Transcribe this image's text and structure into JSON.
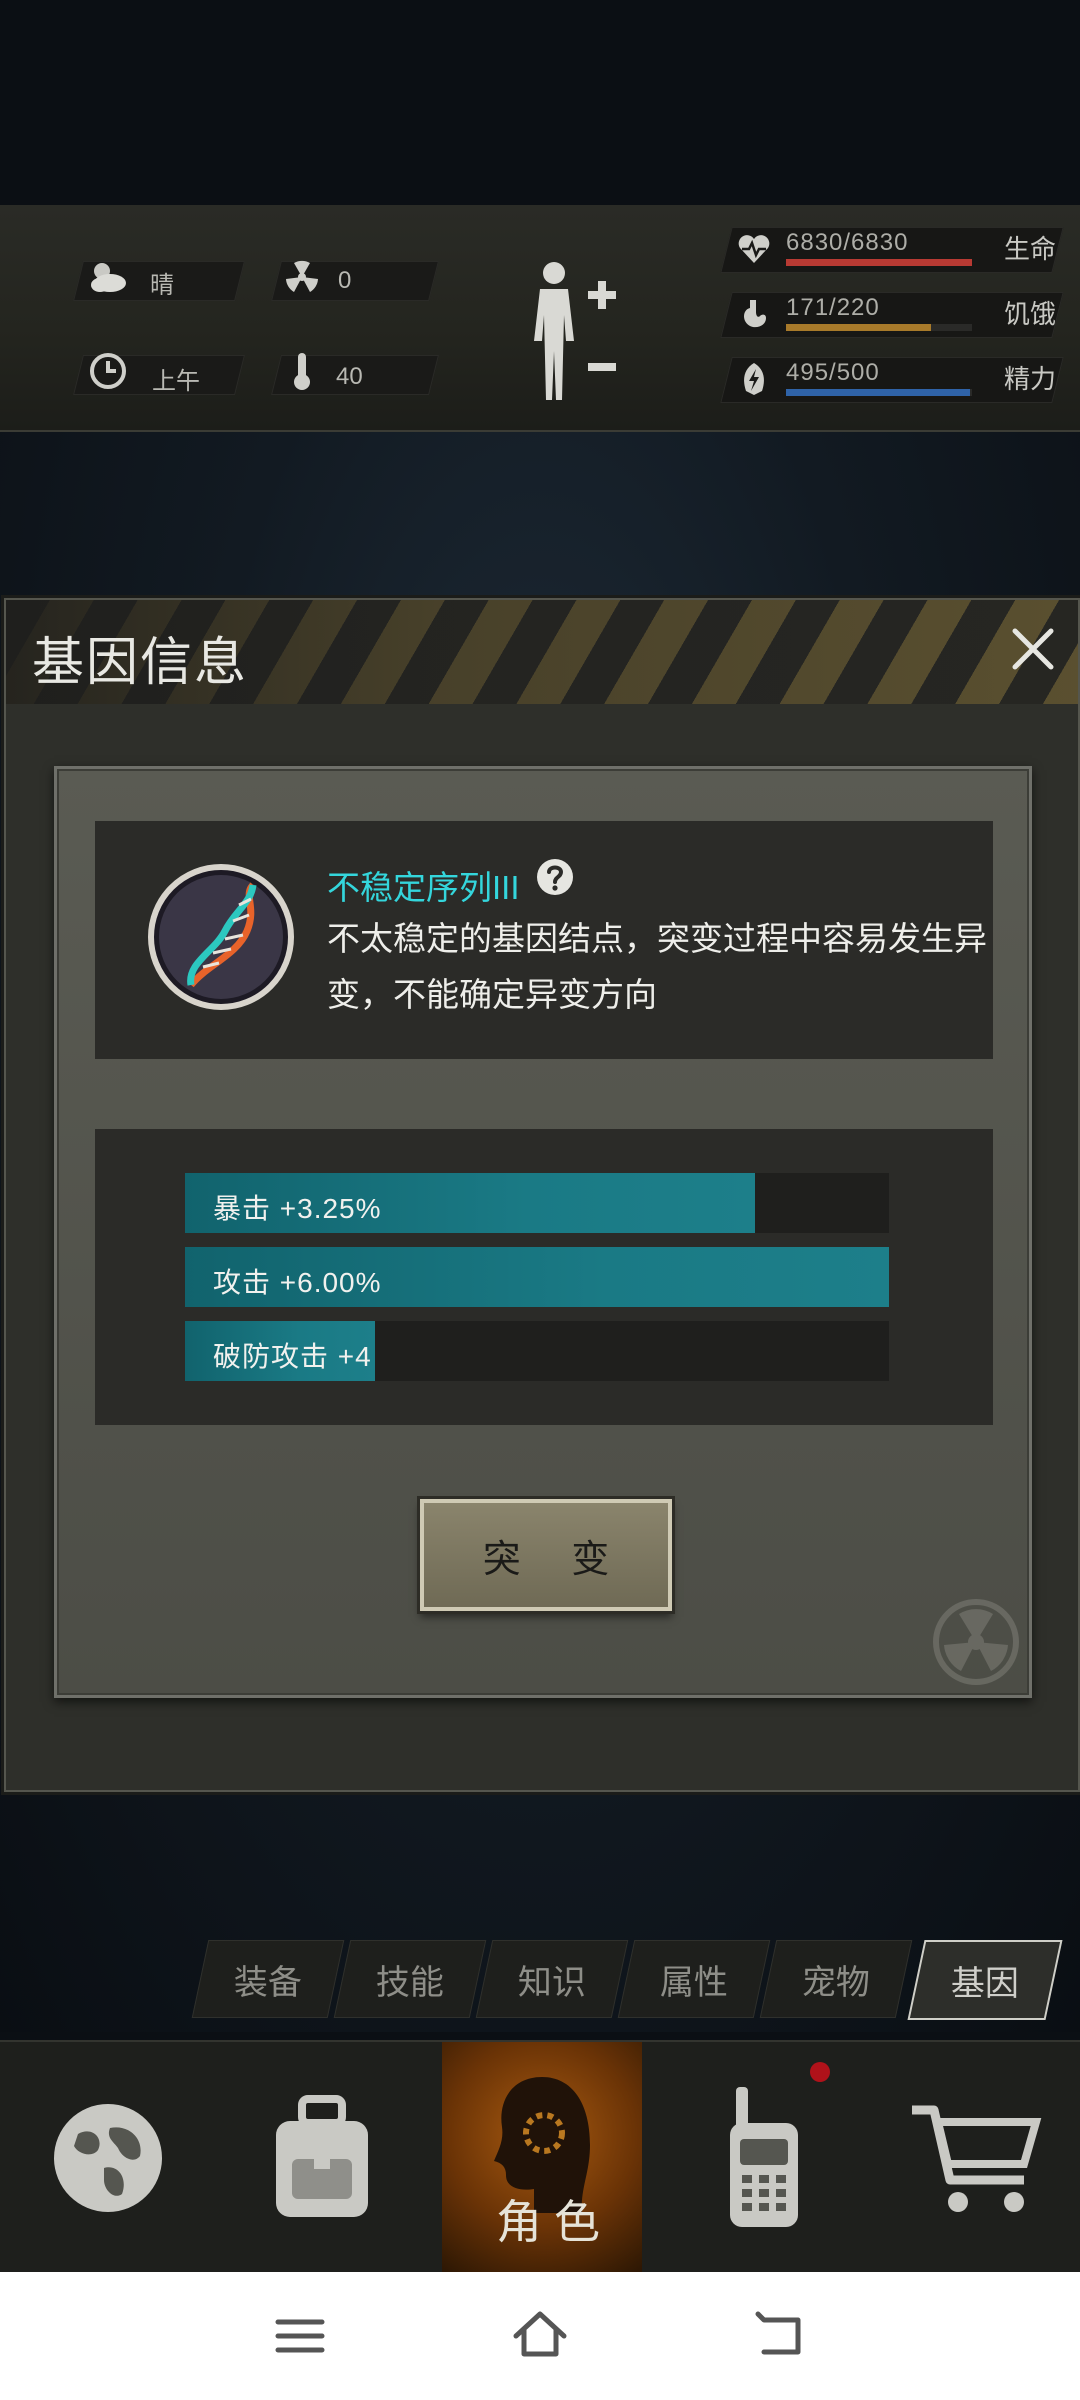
{
  "status": {
    "weather": {
      "icon": "cloud-sun-icon",
      "value": "晴"
    },
    "radiation": {
      "icon": "radiation-icon",
      "value": "0"
    },
    "time": {
      "icon": "clock-icon",
      "value": "上午"
    },
    "temperature": {
      "icon": "thermometer-icon",
      "value": "40"
    },
    "body_toggle_icon": "body-plus-minus-icon",
    "bars": [
      {
        "icon": "heart-icon",
        "value": "6830/6830",
        "label": "生命",
        "fill": 1.0,
        "color": "#b83a33"
      },
      {
        "icon": "stomach-icon",
        "value": "171/220",
        "label": "饥饿",
        "fill": 0.777,
        "color": "#a87a2a"
      },
      {
        "icon": "energy-icon",
        "value": "495/500",
        "label": "精力",
        "fill": 0.99,
        "color": "#2f63a8"
      }
    ]
  },
  "dialog": {
    "title": "基因信息",
    "close_icon": "close-icon",
    "gene": {
      "icon": "dna-icon",
      "name": "不稳定序列III",
      "help_icon": "help-icon",
      "description": "不太稳定的基因结点，突变过程中容易发生异变，不能确定异变方向"
    },
    "stats": [
      {
        "text": "暴击 +3.25%",
        "fill": 0.81
      },
      {
        "text": "攻击 +6.00%",
        "fill": 1.0
      },
      {
        "text": "破防攻击 +4",
        "fill": 0.27
      }
    ],
    "mutate_button": "突 变",
    "watermark_icon": "radiation-icon"
  },
  "tabs": [
    {
      "label": "装备",
      "active": false
    },
    {
      "label": "技能",
      "active": false
    },
    {
      "label": "知识",
      "active": false
    },
    {
      "label": "属性",
      "active": false
    },
    {
      "label": "宠物",
      "active": false
    },
    {
      "label": "基因",
      "active": true
    }
  ],
  "bottom_nav": {
    "items": [
      {
        "icon": "globe-icon"
      },
      {
        "icon": "backpack-icon"
      },
      {
        "icon": "character-head-icon",
        "label": "角色"
      },
      {
        "icon": "walkie-talkie-icon"
      },
      {
        "icon": "cart-icon"
      }
    ]
  },
  "system_nav": {
    "items": [
      {
        "icon": "menu-icon"
      },
      {
        "icon": "home-icon"
      },
      {
        "icon": "back-icon"
      }
    ]
  }
}
